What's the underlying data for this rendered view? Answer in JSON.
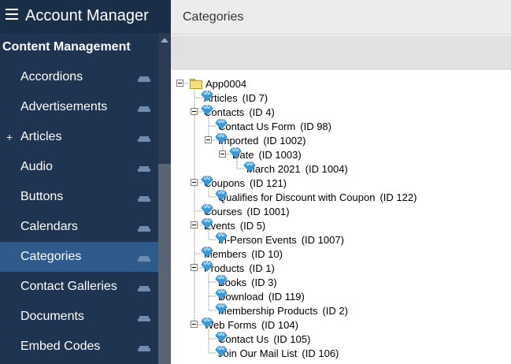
{
  "sidebar": {
    "app_title": "Account Manager",
    "section_title": "Content Management",
    "items": [
      {
        "label": "Accordions",
        "plus": ""
      },
      {
        "label": "Advertisements",
        "plus": ""
      },
      {
        "label": "Articles",
        "plus": "+"
      },
      {
        "label": "Audio",
        "plus": ""
      },
      {
        "label": "Buttons",
        "plus": ""
      },
      {
        "label": "Calendars",
        "plus": ""
      },
      {
        "label": "Categories",
        "plus": "",
        "active": true
      },
      {
        "label": "Contact Galleries",
        "plus": ""
      },
      {
        "label": "Documents",
        "plus": ""
      },
      {
        "label": "Embed Codes",
        "plus": ""
      }
    ]
  },
  "main": {
    "title": "Categories"
  },
  "tree": {
    "root": "App0004",
    "nodes": [
      {
        "label": "Articles",
        "id": "(ID 7)",
        "level": 1,
        "expander": false
      },
      {
        "label": "Contacts",
        "id": "(ID 4)",
        "level": 1,
        "expander": true
      },
      {
        "label": "Contact Us Form",
        "id": "(ID 98)",
        "level": 2,
        "expander": false
      },
      {
        "label": "Imported",
        "id": "(ID 1002)",
        "level": 2,
        "expander": true
      },
      {
        "label": "Date",
        "id": "(ID 1003)",
        "level": 3,
        "expander": true
      },
      {
        "label": "March 2021",
        "id": "(ID 1004)",
        "level": 4,
        "expander": false
      },
      {
        "label": "Coupons",
        "id": "(ID 121)",
        "level": 1,
        "expander": true
      },
      {
        "label": "Qualifies for Discount with Coupon",
        "id": "(ID 122)",
        "level": 2,
        "expander": false
      },
      {
        "label": "Courses",
        "id": "(ID 1001)",
        "level": 1,
        "expander": false
      },
      {
        "label": "Events",
        "id": "(ID 5)",
        "level": 1,
        "expander": true
      },
      {
        "label": "In-Person Events",
        "id": "(ID 1007)",
        "level": 2,
        "expander": false
      },
      {
        "label": "Members",
        "id": "(ID 10)",
        "level": 1,
        "expander": false
      },
      {
        "label": "Products",
        "id": "(ID 1)",
        "level": 1,
        "expander": true
      },
      {
        "label": "Books",
        "id": "(ID 3)",
        "level": 2,
        "expander": false
      },
      {
        "label": "Download",
        "id": "(ID 119)",
        "level": 2,
        "expander": false
      },
      {
        "label": "Membership Products",
        "id": "(ID 2)",
        "level": 2,
        "expander": false
      },
      {
        "label": "Web Forms",
        "id": "(ID 104)",
        "level": 1,
        "expander": true
      },
      {
        "label": "Contact Us",
        "id": "(ID 105)",
        "level": 2,
        "expander": false
      },
      {
        "label": "Join Our Mail List",
        "id": "(ID 106)",
        "level": 2,
        "expander": false
      }
    ]
  },
  "colors": {
    "sidebar_bg": "#1f3450",
    "active_item": "#2e5a8c",
    "gem_fill": "#5ab4ea",
    "folder_fill": "#f6df7c"
  }
}
